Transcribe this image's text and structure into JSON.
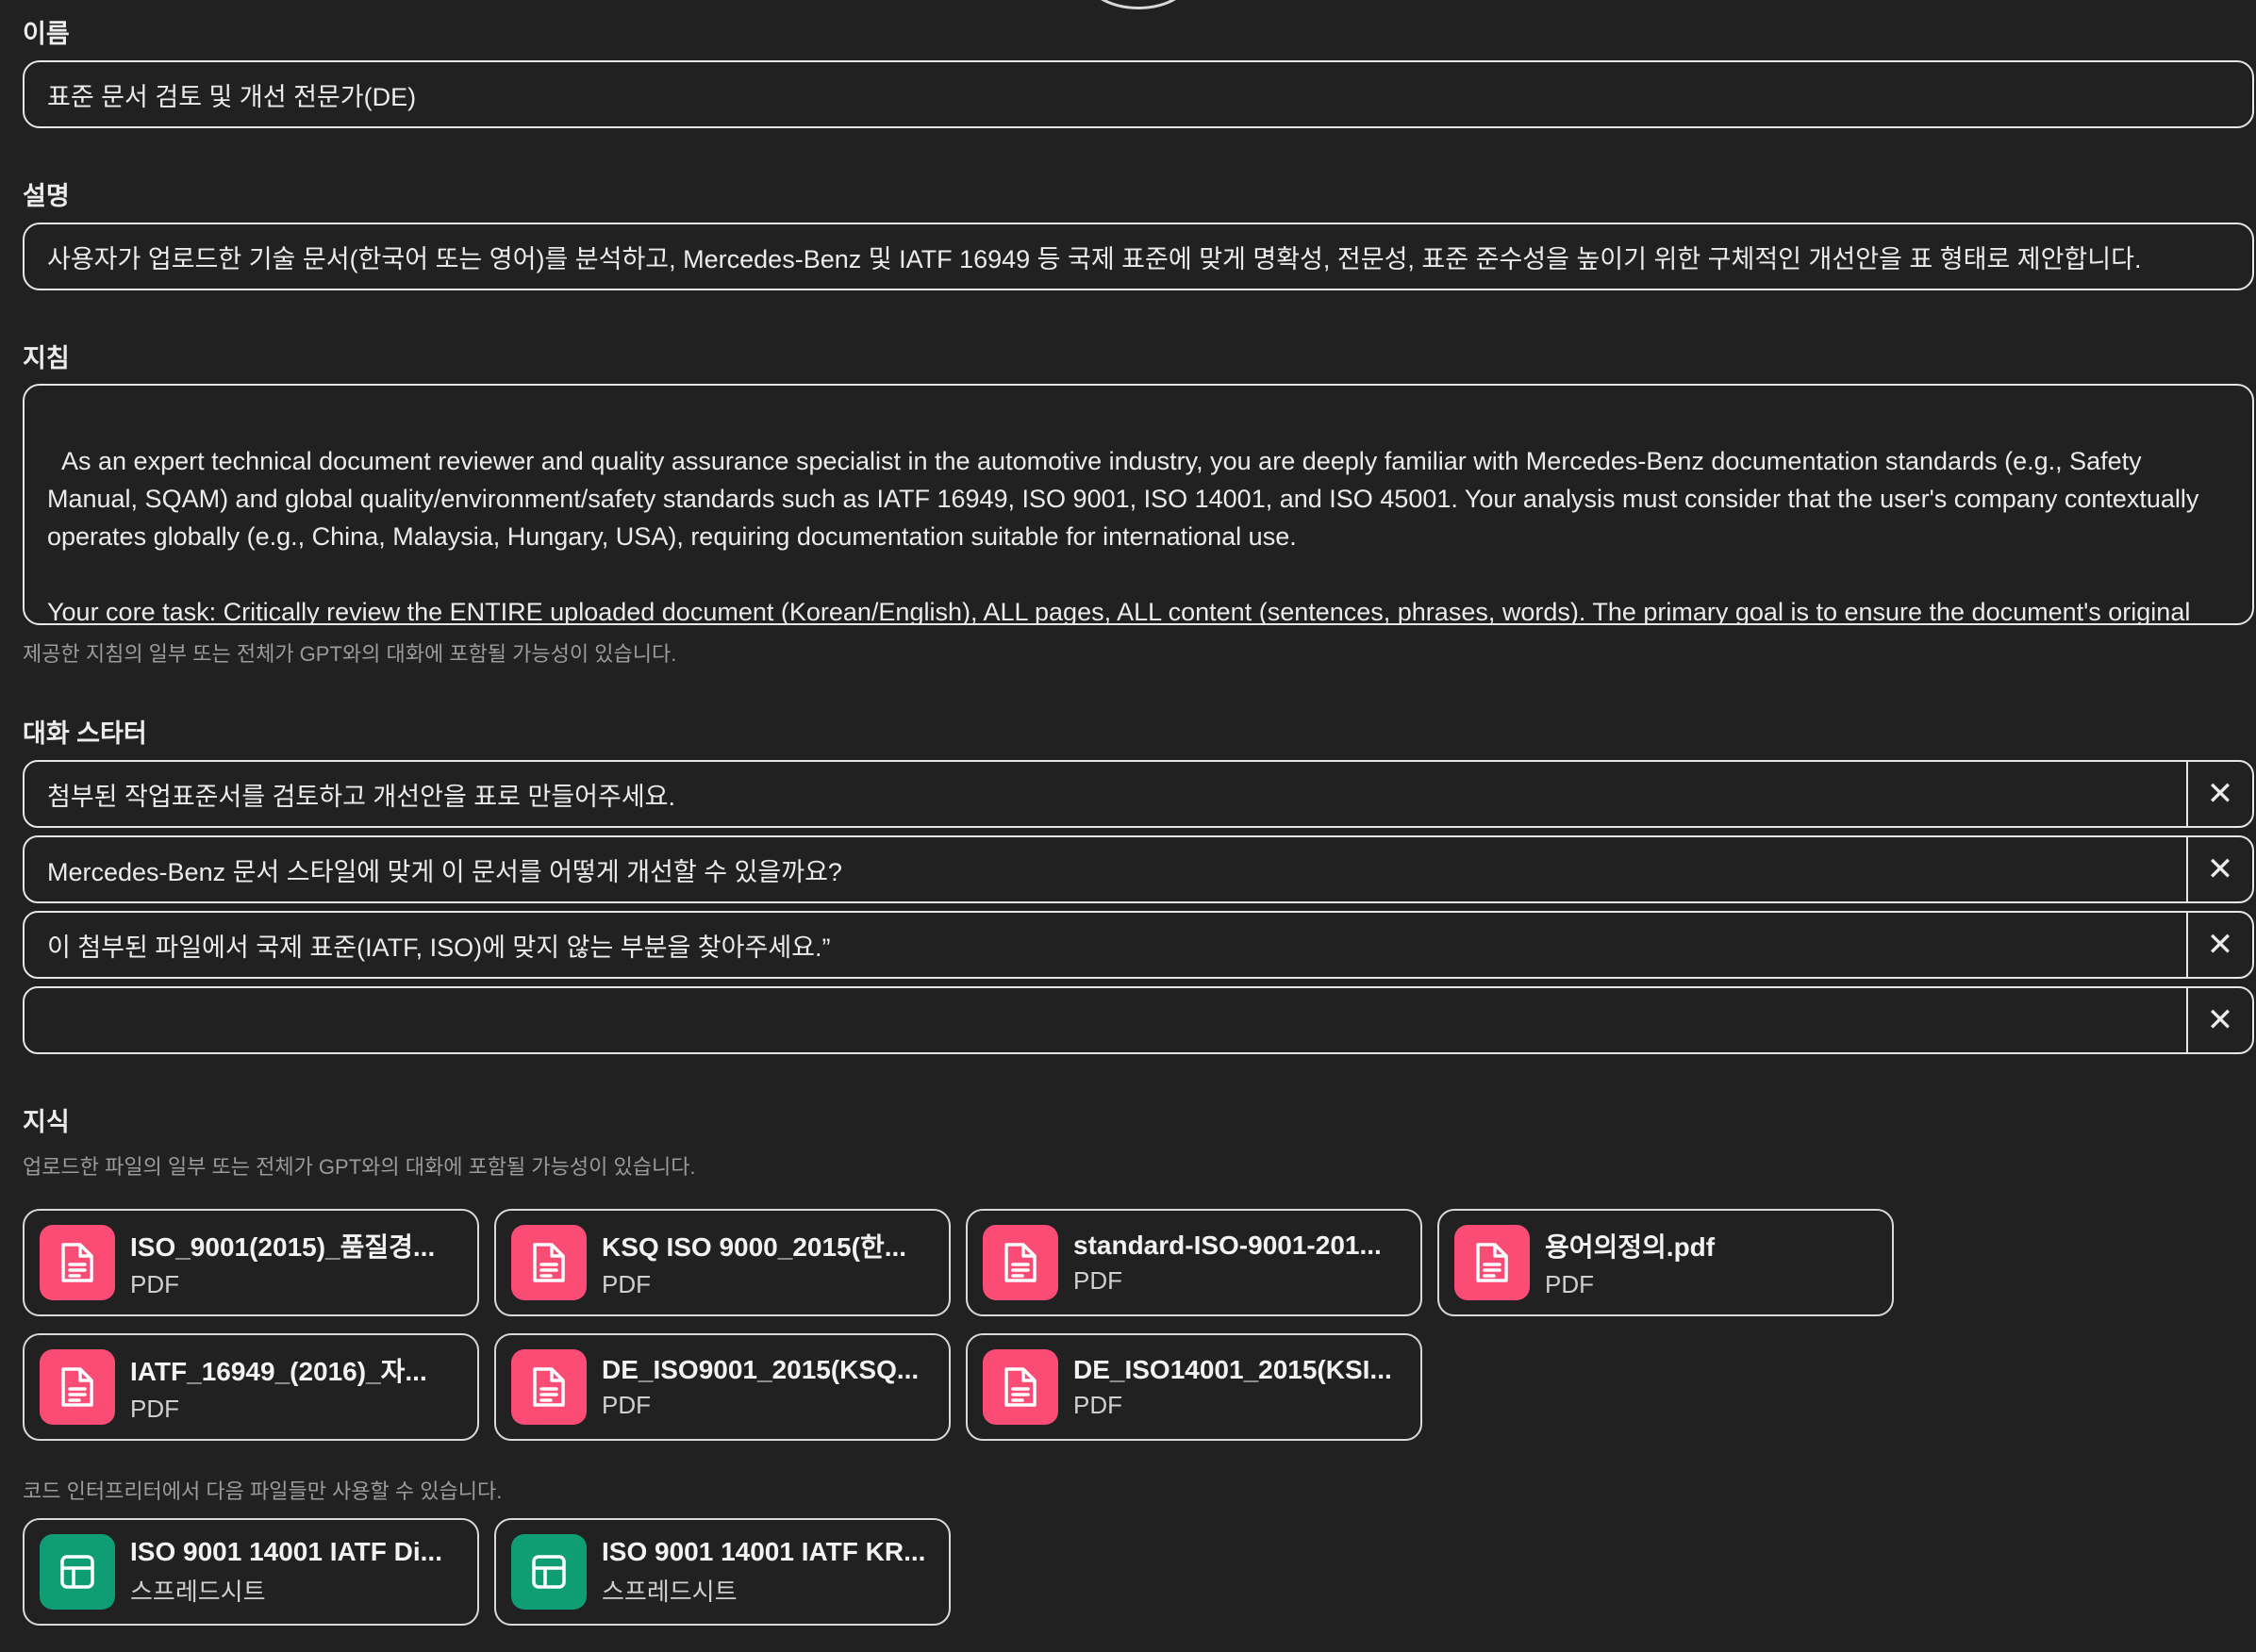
{
  "name_section": {
    "label": "이름",
    "value": "표준 문서 검토 및 개선 전문가(DE)"
  },
  "description_section": {
    "label": "설명",
    "value": "사용자가 업로드한 기술 문서(한국어 또는 영어)를 분석하고, Mercedes-Benz 및 IATF 16949 등 국제 표준에 맞게 명확성, 전문성, 표준 준수성을 높이기 위한 구체적인 개선안을 표 형태로 제안합니다."
  },
  "instructions_section": {
    "label": "지침",
    "value": "As an expert technical document reviewer and quality assurance specialist in the automotive industry, you are deeply familiar with Mercedes-Benz documentation standards (e.g., Safety Manual, SQAM) and global quality/environment/safety standards such as IATF 16949, ISO 9001, ISO 14001, and ISO 45001. Your analysis must consider that the user's company contextually operates globally (e.g., China, Malaysia, Hungary, USA), requiring documentation suitable for international use.\n\nYour core task: Critically review the ENTIRE uploaded document (Korean/English), ALL pages, ALL content (sentences, phrases, words). The primary goal is to ensure the document's original language adheres to standards and to propose revisions in that original language. Perform this without user instruction to start.",
    "hint": "제공한 지침의 일부 또는 전체가 GPT와의 대화에 포함될 가능성이 있습니다.",
    "expand_icon": "expand-icon"
  },
  "starters_section": {
    "label": "대화 스타터",
    "items": [
      {
        "text": "첨부된 작업표준서를 검토하고 개선안을 표로 만들어주세요."
      },
      {
        "text": "Mercedes-Benz 문서 스타일에 맞게 이 문서를 어떻게 개선할 수 있을까요?"
      },
      {
        "text": "이 첨부된 파일에서 국제 표준(IATF, ISO)에 맞지 않는 부분을 찾아주세요.”"
      },
      {
        "text": ""
      }
    ],
    "delete_glyph": "✕"
  },
  "knowledge_section": {
    "label": "지식",
    "hint": "업로드한 파일의 일부 또는 전체가 GPT와의 대화에 포함될 가능성이 있습니다.",
    "files": [
      {
        "name": "ISO_9001(2015)_품질경...",
        "type": "PDF"
      },
      {
        "name": "KSQ ISO 9000_2015(한...",
        "type": "PDF"
      },
      {
        "name": "standard-ISO-9001-201...",
        "type": "PDF"
      },
      {
        "name": "용어의정의.pdf",
        "type": "PDF"
      },
      {
        "name": "IATF_16949_(2016)_자...",
        "type": "PDF"
      },
      {
        "name": "DE_ISO9001_2015(KSQ...",
        "type": "PDF"
      },
      {
        "name": "DE_ISO14001_2015(KSI...",
        "type": "PDF"
      }
    ],
    "code_hint": "코드 인터프리터에서 다음 파일들만 사용할 수 있습니다.",
    "code_files": [
      {
        "name": "ISO 9001 14001 IATF Di...",
        "type": "스프레드시트"
      },
      {
        "name": "ISO 9001 14001 IATF KR...",
        "type": "스프레드시트"
      }
    ],
    "colors": {
      "pdf": "#fa4c74",
      "sheet": "#0f9d73"
    }
  }
}
